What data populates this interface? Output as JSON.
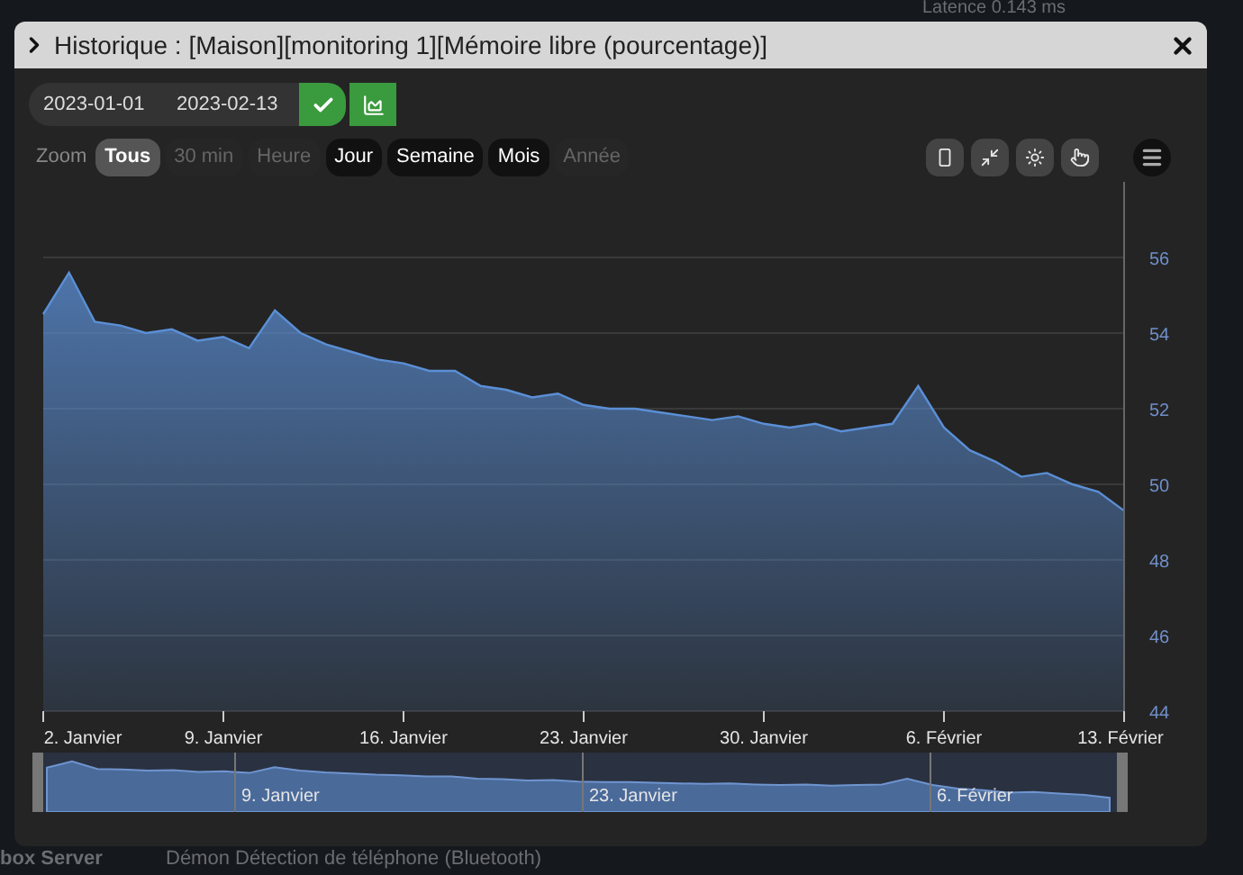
{
  "background": {
    "top_text": "Latence 0.143 ms",
    "bottom_left_text": "box Server",
    "bottom_text": "Démon Détection de téléphone (Bluetooth)"
  },
  "window": {
    "title": "Historique : [Maison][monitoring 1][Mémoire libre (pourcentage)]"
  },
  "date_range": {
    "start": "2023-01-01",
    "end": "2023-02-13"
  },
  "zoom": {
    "label": "Zoom",
    "options": [
      {
        "label": "Tous",
        "selected": true,
        "disabled": false
      },
      {
        "label": "30 min",
        "selected": false,
        "disabled": true
      },
      {
        "label": "Heure",
        "selected": false,
        "disabled": true
      },
      {
        "label": "Jour",
        "selected": false,
        "disabled": false
      },
      {
        "label": "Semaine",
        "selected": false,
        "disabled": false
      },
      {
        "label": "Mois",
        "selected": false,
        "disabled": false
      },
      {
        "label": "Année",
        "selected": false,
        "disabled": true
      }
    ]
  },
  "chart_data": {
    "type": "area",
    "x": [
      "2023-01-02",
      "2023-01-03",
      "2023-01-04",
      "2023-01-05",
      "2023-01-06",
      "2023-01-07",
      "2023-01-08",
      "2023-01-09",
      "2023-01-10",
      "2023-01-11",
      "2023-01-12",
      "2023-01-13",
      "2023-01-14",
      "2023-01-15",
      "2023-01-16",
      "2023-01-17",
      "2023-01-18",
      "2023-01-19",
      "2023-01-20",
      "2023-01-21",
      "2023-01-22",
      "2023-01-23",
      "2023-01-24",
      "2023-01-25",
      "2023-01-26",
      "2023-01-27",
      "2023-01-28",
      "2023-01-29",
      "2023-01-30",
      "2023-01-31",
      "2023-02-01",
      "2023-02-02",
      "2023-02-03",
      "2023-02-04",
      "2023-02-05",
      "2023-02-06",
      "2023-02-07",
      "2023-02-08",
      "2023-02-09",
      "2023-02-10",
      "2023-02-11",
      "2023-02-12",
      "2023-02-13"
    ],
    "xlim": [
      "2023-01-02",
      "2023-02-13"
    ],
    "xticks": [
      {
        "value": "2023-01-02",
        "label": "2. Janvier"
      },
      {
        "value": "2023-01-09",
        "label": "9. Janvier"
      },
      {
        "value": "2023-01-16",
        "label": "16. Janvier"
      },
      {
        "value": "2023-01-23",
        "label": "23. Janvier"
      },
      {
        "value": "2023-01-30",
        "label": "30. Janvier"
      },
      {
        "value": "2023-02-06",
        "label": "6. Février"
      },
      {
        "value": "2023-02-13",
        "label": "13. Février"
      }
    ],
    "series": [
      {
        "color": "#5b8fd6",
        "values": [
          54.5,
          55.6,
          54.3,
          54.2,
          54.0,
          54.1,
          53.8,
          53.9,
          53.6,
          54.6,
          54.0,
          53.7,
          53.5,
          53.3,
          53.2,
          53.0,
          53.0,
          52.6,
          52.5,
          52.3,
          52.4,
          52.1,
          52.0,
          52.0,
          51.9,
          51.8,
          51.7,
          51.8,
          51.6,
          51.5,
          51.6,
          51.4,
          51.5,
          51.6,
          52.6,
          51.5,
          50.9,
          50.6,
          50.2,
          50.3,
          50.0,
          49.8,
          49.3
        ]
      }
    ],
    "ylim": [
      44,
      58
    ],
    "yticks": [
      44,
      46,
      48,
      50,
      52,
      54,
      56
    ],
    "grid": true
  },
  "navigator": {
    "labels": [
      "9. Janvier",
      "23. Janvier",
      "6. Février"
    ]
  }
}
